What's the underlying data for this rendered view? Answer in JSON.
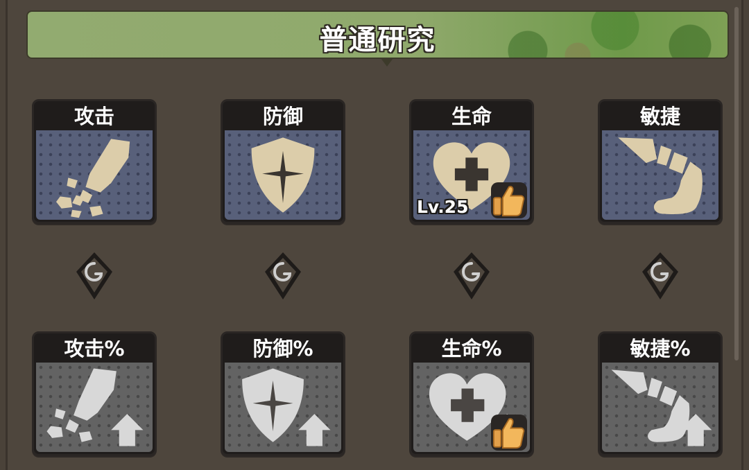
{
  "panel": {
    "title": "普通研究"
  },
  "research": {
    "row1": [
      {
        "label": "攻击",
        "icon": "sword-icon"
      },
      {
        "label": "防御",
        "icon": "shield-icon"
      },
      {
        "label": "生命",
        "icon": "heart-icon",
        "level": "Lv.25",
        "recommended": true
      },
      {
        "label": "敏捷",
        "icon": "boot-icon"
      }
    ],
    "row2": [
      {
        "label": "攻击%",
        "icon": "sword-up-icon",
        "locked": true
      },
      {
        "label": "防御%",
        "icon": "shield-up-icon",
        "locked": true
      },
      {
        "label": "生命%",
        "icon": "heart-up-icon",
        "locked": true,
        "recommended": true
      },
      {
        "label": "敏捷%",
        "icon": "boot-up-icon",
        "locked": true
      }
    ]
  },
  "colors": {
    "active_icon": "#dccdaa",
    "locked_icon": "#d8d8d8",
    "thumb": "#e3a04a"
  }
}
